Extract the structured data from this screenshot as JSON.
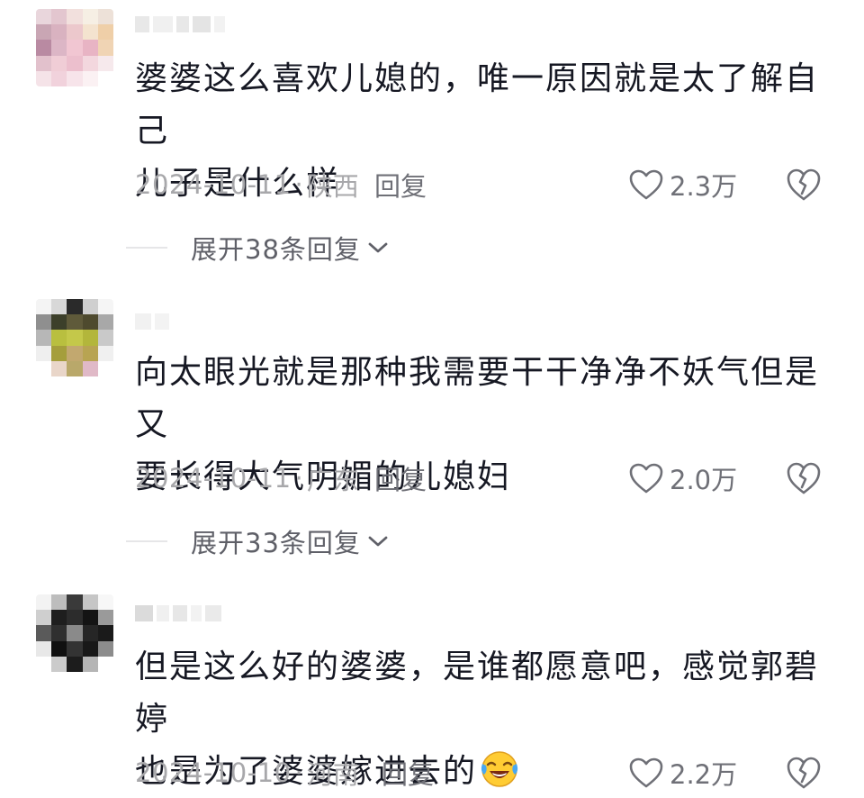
{
  "comments": [
    {
      "content_line1": "婆婆这么喜欢儿媳的，唯一原因就是太了解自己",
      "content_line2": "儿子是什么样",
      "date": "2024-10-11",
      "location": "陕西",
      "reply_label": "回复",
      "likes": "2.3万",
      "expand_label": "展开38条回复"
    },
    {
      "content_line1": "向太眼光就是那种我需要干干净净不妖气但是又",
      "content_line2": "要长得大气明媚的儿媳妇",
      "date": "2024-10-11",
      "location": "广东",
      "reply_label": "回复",
      "likes": "2.0万",
      "expand_label": "展开33条回复"
    },
    {
      "content_line1": "但是这么好的婆婆，是谁都愿意吧，感觉郭碧婷",
      "content_line2": "也是为了婆婆嫁进去的",
      "date": "2024-10-10",
      "location": "河南",
      "reply_label": "回复",
      "likes": "2.2万"
    }
  ],
  "icons": {
    "like": "heart-outline-icon",
    "dislike": "broken-heart-icon",
    "expand": "chevron-down-icon",
    "emoji": "laughing-crying-emoji"
  },
  "colors": {
    "text": "#161823",
    "meta": "#a8a8ab",
    "action": "#6f7077"
  }
}
